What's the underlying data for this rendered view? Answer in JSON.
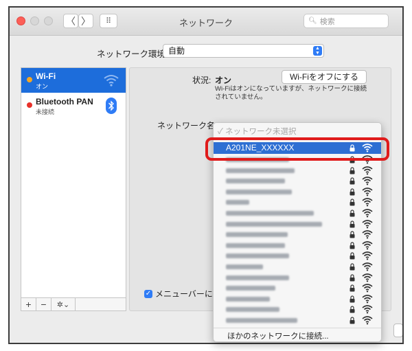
{
  "window": {
    "title": "ネットワーク"
  },
  "toolbar": {
    "back_glyph": "〈",
    "forward_glyph": "〉",
    "grid_glyph": "⠿",
    "search_placeholder": "検索",
    "search_icon": "🔍︎"
  },
  "location": {
    "label": "ネットワーク環境:",
    "value": "自動"
  },
  "sidebar": {
    "services": [
      {
        "name": "Wi-Fi",
        "status": "オン",
        "dot_color": "#f5a623",
        "selected": true,
        "icon": "wifi-icon"
      },
      {
        "name": "Bluetooth PAN",
        "status": "未接続",
        "dot_color": "#e8312a",
        "selected": false,
        "icon": "bluetooth-icon"
      }
    ],
    "buttons": {
      "add": "+",
      "remove": "−",
      "action": "✲⌄"
    }
  },
  "detail": {
    "status_label": "状況:",
    "status_value": "オン",
    "toggle_button": "Wi-Fiをオフにする",
    "status_description": "Wi-Fiはオンになっていますが、ネットワークに接続されていません。",
    "network_name_label": "ネットワーク名",
    "menubar_checkbox_label": "メニューバーにWi-",
    "checkbox_mark": "✓"
  },
  "dropdown": {
    "header": "✓ ネットワーク未選択",
    "selected_network": "A201NE_XXXXXX",
    "other_networks": "ほかのネットワークに接続...",
    "network_count_blurred": 16
  },
  "colors": {
    "accent": "#2f7cf6",
    "selection": "#1d6ddb",
    "highlight": "#e01b1b"
  }
}
